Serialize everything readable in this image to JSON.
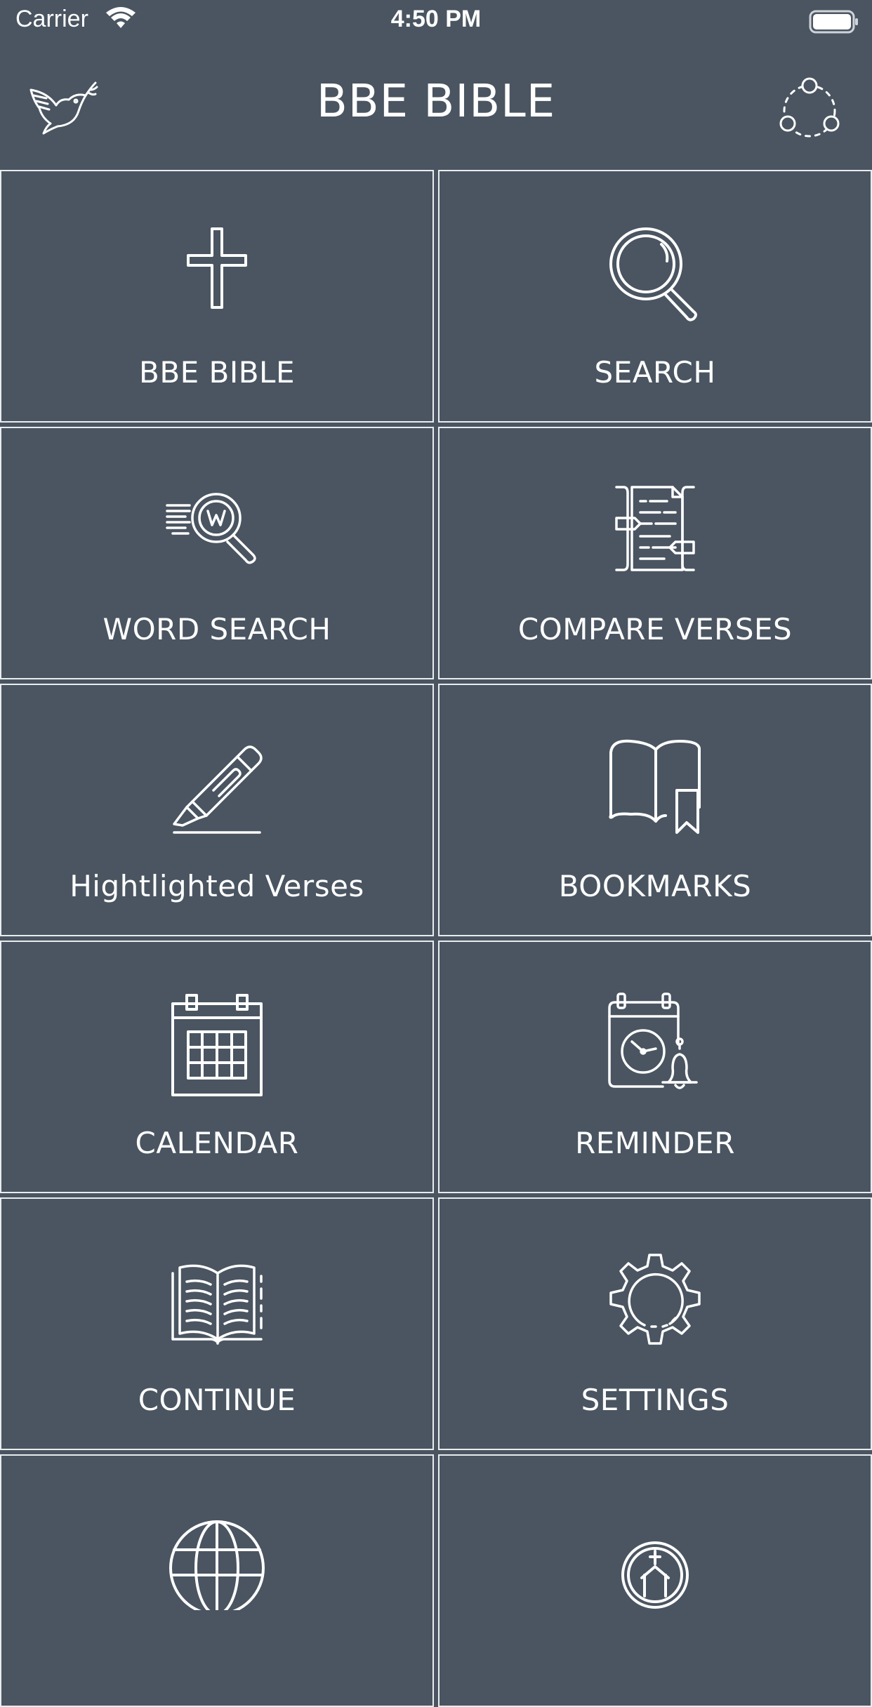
{
  "statusbar": {
    "carrier": "Carrier",
    "time": "4:50 PM"
  },
  "header": {
    "title": "BBE BIBLE",
    "left_icon": "dove-icon",
    "right_icon": "share-icon"
  },
  "tiles": [
    {
      "label": "BBE BIBLE",
      "icon": "cross-icon"
    },
    {
      "label": "SEARCH",
      "icon": "magnifier-icon"
    },
    {
      "label": "WORD SEARCH",
      "icon": "word-search-icon"
    },
    {
      "label": "COMPARE VERSES",
      "icon": "compare-document-icon"
    },
    {
      "label": "Hightlighted Verses",
      "icon": "highlighter-icon"
    },
    {
      "label": "BOOKMARKS",
      "icon": "book-bookmark-icon"
    },
    {
      "label": "CALENDAR",
      "icon": "calendar-icon"
    },
    {
      "label": "REMINDER",
      "icon": "calendar-clock-bell-icon"
    },
    {
      "label": "CONTINUE",
      "icon": "open-book-icon"
    },
    {
      "label": "SETTINGS",
      "icon": "gear-icon"
    },
    {
      "label": "",
      "icon": "globe-icon"
    },
    {
      "label": "",
      "icon": "church-icon"
    }
  ]
}
